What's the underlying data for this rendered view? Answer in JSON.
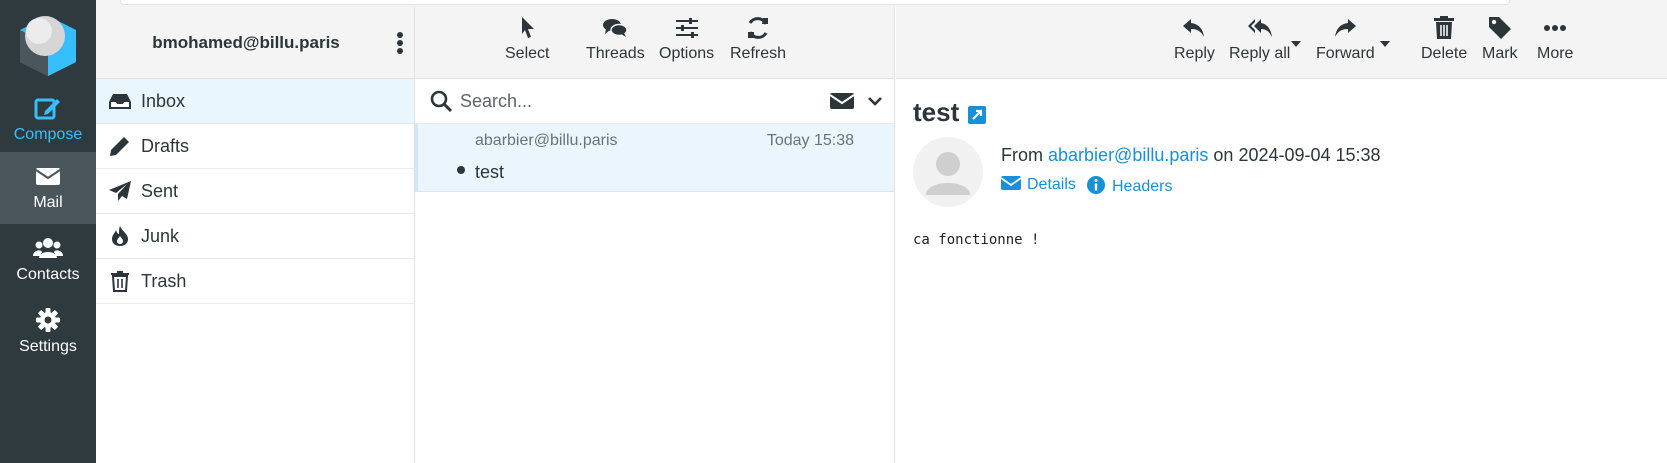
{
  "taskmenu": {
    "items": [
      {
        "label": "Compose",
        "icon": "compose-icon"
      },
      {
        "label": "Mail",
        "icon": "mail-icon"
      },
      {
        "label": "Contacts",
        "icon": "contacts-icon"
      },
      {
        "label": "Settings",
        "icon": "gear-icon"
      }
    ]
  },
  "account": {
    "email": "bmohamed@billu.paris"
  },
  "folders": [
    {
      "label": "Inbox",
      "icon": "inbox-icon"
    },
    {
      "label": "Drafts",
      "icon": "pencil-icon"
    },
    {
      "label": "Sent",
      "icon": "paper-plane-icon"
    },
    {
      "label": "Junk",
      "icon": "fire-icon"
    },
    {
      "label": "Trash",
      "icon": "trash-icon"
    }
  ],
  "list_toolbar": {
    "select": "Select",
    "threads": "Threads",
    "options": "Options",
    "refresh": "Refresh"
  },
  "search": {
    "placeholder": "Search..."
  },
  "messages": [
    {
      "from": "abarbier@billu.paris",
      "date": "Today 15:38",
      "subject": "test"
    }
  ],
  "preview_toolbar": {
    "reply": "Reply",
    "reply_all": "Reply all",
    "forward": "Forward",
    "delete": "Delete",
    "mark": "Mark",
    "more": "More"
  },
  "message": {
    "subject": "test",
    "from_prefix": "From",
    "from_address": "abarbier@billu.paris",
    "on_word": "on",
    "date": "2024-09-04 15:38",
    "details_label": "Details",
    "headers_label": "Headers",
    "body": "ca fonctionne !"
  },
  "colors": {
    "accent": "#37beff",
    "link": "#1890d8",
    "sidebar_bg": "#2f3a3f",
    "selected_bg": "#eaf6fd"
  }
}
